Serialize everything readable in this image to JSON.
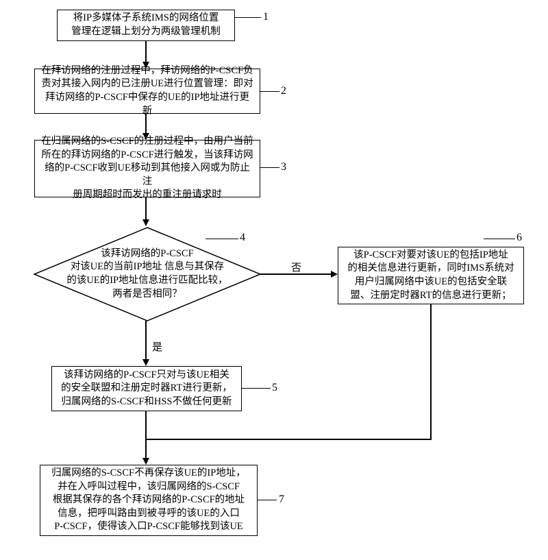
{
  "nodes": {
    "n1": "将IP多媒体子系统IMS的网络位置\n管理在逻辑上划分为两级管理机制",
    "n2": "在拜访网络的注册过程中，拜访网络的P-CSCF负\n责对其接入网内的已注册UE进行位置管理：即对\n拜访网络的P-CSCF中保存的UE的IP地址进行更新",
    "n3": "在归属网络的S-CSCF的注册过程中，由用户当前\n所在的拜访网络的P-CSCF进行触发，当该拜访网\n络的P-CSCF收到UE移动到其他接入网或为防止注\n册周期超时而发出的重注册请求时",
    "d4": "该拜访网络的P-CSCF\n对该UE的当前IP地址 信息与其保存\n的该UE的IP地址信息进行匹配比较，\n两者是否相同？",
    "n5": "该拜访网络的P-CSCF只对与该UE相关\n的安全联盟和注册定时器RT进行更新，\n归属网络的S-CSCF和HSS不做任何更新",
    "n6": "该P-CSCF对要对该UE的包括IP地址\n的相关信息进行更新，同时IMS系统对\n用户归属网络中该UE的包括安全联\n盟、注册定时器RT的信息进行更新；",
    "n7": "归属网络的S-CSCF不再保存该UE的IP地址，\n并在入呼叫过程中，该归属网络的S-CSCF\n根据其保存的各个拜访网络的P-CSCF的地址\n信息，把呼叫路由到被寻呼的该UE的入口\nP-CSCF，使得该入口P-CSCF能够找到该UE"
  },
  "labels": {
    "l1": "1",
    "l2": "2",
    "l3": "3",
    "l4": "4",
    "l5": "5",
    "l6": "6",
    "l7": "7"
  },
  "edges": {
    "yes": "是",
    "no": "否"
  }
}
